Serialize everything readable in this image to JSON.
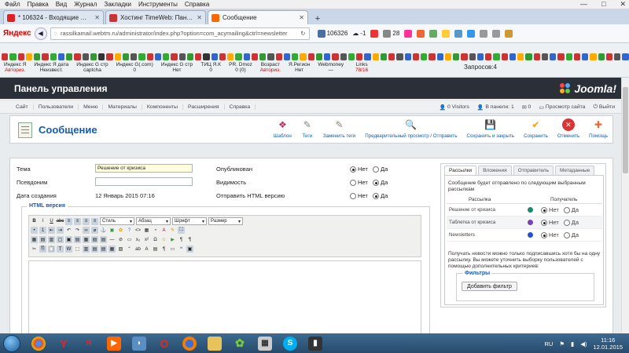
{
  "menubar": [
    "Файл",
    "Правка",
    "Вид",
    "Журнал",
    "Закладки",
    "Инструменты",
    "Справка"
  ],
  "window_controls": [
    "—",
    "□",
    "✕"
  ],
  "tabs": [
    {
      "label": "* 106324 - Входящие — Янд...",
      "icon_color": "#d22"
    },
    {
      "label": "Хостинг TimeWeb: Панел...",
      "icon_color": "#c33"
    },
    {
      "label": "Сообщение",
      "icon_color": "#f60"
    }
  ],
  "navbar": {
    "brand": "Яндекс",
    "url": "rassilkamail.webtm.ru/administrator/index.php?option=com_acymailing&ctrl=newsletter",
    "mail_count": "106326",
    "weather": "-1",
    "counter": "28"
  },
  "seo": {
    "cells": [
      {
        "title": "Индекс Я",
        "value": "Авториз.",
        "red": true
      },
      {
        "title": "Индекс Я дата",
        "value": "Неизвест.",
        "red": false
      },
      {
        "title": "Индекс G стр",
        "value": "captcha",
        "red": false
      },
      {
        "title": "Индекс G(.com)",
        "value": "0",
        "red": false
      },
      {
        "title": "Индекс G стр",
        "value": "Нет",
        "red": false
      },
      {
        "title": "ТИЦ Я.К",
        "value": "0",
        "red": false
      },
      {
        "title": "PR. Dmoz",
        "value": "0 (0)",
        "red": false
      },
      {
        "title": "Возраст",
        "value": "Авториз.",
        "red": true
      },
      {
        "title": "Я.Регион",
        "value": "Нет",
        "red": false
      },
      {
        "title": "Webmoney",
        "value": "—",
        "red": false
      },
      {
        "title": "Links",
        "value": "78/16",
        "red": false
      }
    ],
    "requests": "Запросов:4"
  },
  "joomla": {
    "header_title": "Панель управления",
    "logo": "Joomla!",
    "submenu": [
      "Сайт",
      "Пользователи",
      "Меню",
      "Материалы",
      "Компоненты",
      "Расширения",
      "Справка"
    ],
    "status": {
      "visitors": "0 Visitors",
      "in_panel": "В панели: 1",
      "zero": "0",
      "view_site": "Просмотр сайта",
      "logout": "Выйти"
    }
  },
  "page": {
    "title": "Сообщение",
    "tools": [
      {
        "label": "Шаблон",
        "icon": "template-icon"
      },
      {
        "label": "Теги",
        "icon": "tags-icon"
      },
      {
        "label": "Заменить теги",
        "icon": "replace-tags-icon"
      },
      {
        "label": "Предварительный просмотр / Отправить",
        "icon": "preview-icon"
      },
      {
        "label": "Сохранить и закрыть",
        "icon": "save-close-icon"
      },
      {
        "label": "Сохранить",
        "icon": "check-icon"
      },
      {
        "label": "Отменить",
        "icon": "cancel-icon"
      },
      {
        "label": "Помощь",
        "icon": "help-icon"
      }
    ]
  },
  "form": {
    "subject_label": "Тема",
    "subject_value": "Решение от кризиса",
    "alias_label": "Псевдоним",
    "alias_value": "",
    "created_label": "Дата создания",
    "created_value": "12 Январь 2015 07:16",
    "published_label": "Опубликован",
    "visible_label": "Видимость",
    "html_label": "Отправить HTML версию",
    "no": "Нет",
    "yes": "Да"
  },
  "editor": {
    "legend": "HTML версия",
    "style_select": "Стиль",
    "paragraph_select": "Абзац",
    "font_select": "Шрифт",
    "size_select": "Размер"
  },
  "side": {
    "tabs": [
      "Рассылки",
      "Вложения",
      "Отправитель",
      "Метаданные"
    ],
    "desc": "Сообщение будет отправлено по следующим выбранным рассылкам",
    "col_list": "Рассылка",
    "col_receive": "Получатель",
    "lists": [
      {
        "name": "Решение от кризиса",
        "color": "#1a8a6a"
      },
      {
        "name": "Таблетка от кризиса",
        "color": "#7a3fb0"
      },
      {
        "name": "Newsletters",
        "color": "#2255cc"
      }
    ],
    "no": "Нет",
    "yes": "Да",
    "note": "Получать новости можно только подписавшись хотя бы на одну рассылку. Вы можете уточнить выборку пользователей с помощью дополнительных критериев:",
    "filters_legend": "Фильтры",
    "add_filter": "Добавить фильтр"
  },
  "taskbar": {
    "lang": "RU",
    "time": "11:16",
    "date": "12.01.2015"
  }
}
